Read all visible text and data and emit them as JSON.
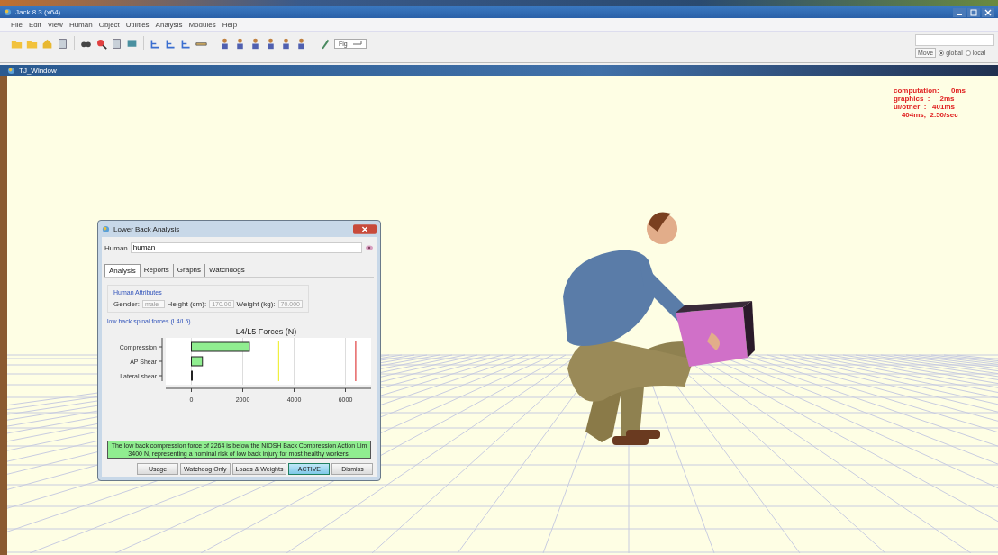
{
  "app_window": {
    "title": "Jack 8.3  (x64)"
  },
  "menu": [
    "File",
    "Edit",
    "View",
    "Human",
    "Object",
    "Utilities",
    "Analysis",
    "Modules",
    "Help"
  ],
  "toolbar": {
    "figure_selector": "Fig",
    "move_button": "Move",
    "coordinate_modes": [
      {
        "label": "global",
        "selected": true
      },
      {
        "label": "local",
        "selected": false
      }
    ]
  },
  "viewport": {
    "title": "TJ_Window",
    "timings": [
      "computation:      0ms",
      "graphics  :     2ms",
      "ui/other  :   401ms",
      "    404ms,  2.50/sec"
    ]
  },
  "dialog": {
    "title": "Lower Back Analysis",
    "human_label": "Human",
    "human_value": "human",
    "tabs": [
      {
        "label": "Analysis",
        "selected": true
      },
      {
        "label": "Reports",
        "selected": false
      },
      {
        "label": "Graphs",
        "selected": false
      },
      {
        "label": "Watchdogs",
        "selected": false
      }
    ],
    "attributes_title": "Human Attributes",
    "gender_label": "Gender:",
    "gender_value": "male",
    "height_label": "Height  (cm):",
    "height_value": "170.00",
    "weight_label": "Weight  (kg):",
    "weight_value": "70.000",
    "section_link": "low back spinal forces (L4/L5)",
    "chart_data": {
      "type": "bar",
      "orientation": "horizontal",
      "title": "L4/L5 Forces (N)",
      "categories": [
        "Compression",
        "AP Shear",
        "Lateral shear"
      ],
      "values": [
        2260,
        430,
        0
      ],
      "xlim": [
        -1000,
        7000
      ],
      "xticks": [
        0,
        2000,
        4000,
        6000
      ],
      "grid": true,
      "ref_lines": [
        {
          "axis": "x",
          "value": 3400,
          "color": "#f0f040"
        },
        {
          "axis": "x",
          "value": 6400,
          "color": "#e04040"
        }
      ]
    },
    "message_lines": [
      "The low back compression force of 2264 is below the NIOSH Back Compression Action Lim",
      "3400 N, representing a nominal risk of low back injury for most healthy workers."
    ],
    "buttons": [
      {
        "label": "Usage",
        "active": false
      },
      {
        "label": "Watchdog Only",
        "active": false
      },
      {
        "label": "Loads & Weights",
        "active": false
      },
      {
        "label": "ACTIVE",
        "active": true
      },
      {
        "label": "Dismiss",
        "active": false
      }
    ]
  }
}
